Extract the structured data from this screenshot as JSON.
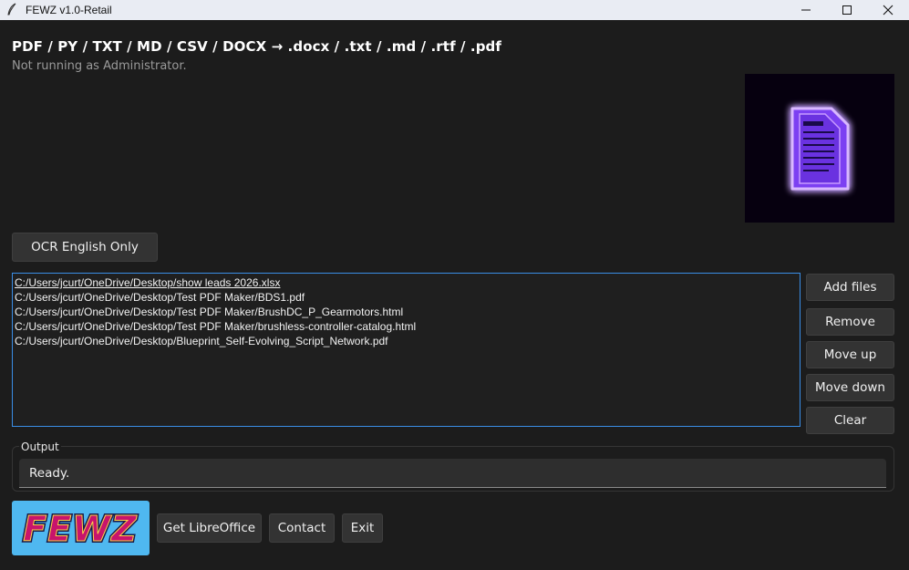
{
  "window": {
    "title": "FEWZ v1.0-Retail",
    "controls": [
      "minimize",
      "maximize",
      "close"
    ]
  },
  "header": {
    "title": "PDF / PY / TXT / MD / CSV / DOCX → .docx / .txt / .md / .rtf / .pdf",
    "admin_status": "Not running as Administrator."
  },
  "ocr_button": {
    "label": "OCR English Only"
  },
  "files": {
    "items": [
      "C:/Users/jcurt/OneDrive/Desktop/show leads 2026.xlsx",
      "C:/Users/jcurt/OneDrive/Desktop/Test PDF Maker/BDS1.pdf",
      "C:/Users/jcurt/OneDrive/Desktop/Test PDF Maker/BrushDC_P_Gearmotors.html",
      "C:/Users/jcurt/OneDrive/Desktop/Test PDF Maker/brushless-controller-catalog.html",
      "C:/Users/jcurt/OneDrive/Desktop/Blueprint_Self-Evolving_Script_Network.pdf"
    ]
  },
  "side_buttons": {
    "add": "Add files",
    "remove": "Remove",
    "move_up": "Move up",
    "move_down": "Move down",
    "clear": "Clear"
  },
  "output": {
    "label": "Output",
    "status": "Ready."
  },
  "footer": {
    "brand_text": "FEWZ",
    "libreoffice": "Get LibreOffice",
    "contact": "Contact",
    "exit": "Exit"
  },
  "colors": {
    "background": "#1c1c1c",
    "accent_border": "#3a8ee6",
    "logo_glow": "#b36bff",
    "brand_bg": "#4fb8f0"
  }
}
